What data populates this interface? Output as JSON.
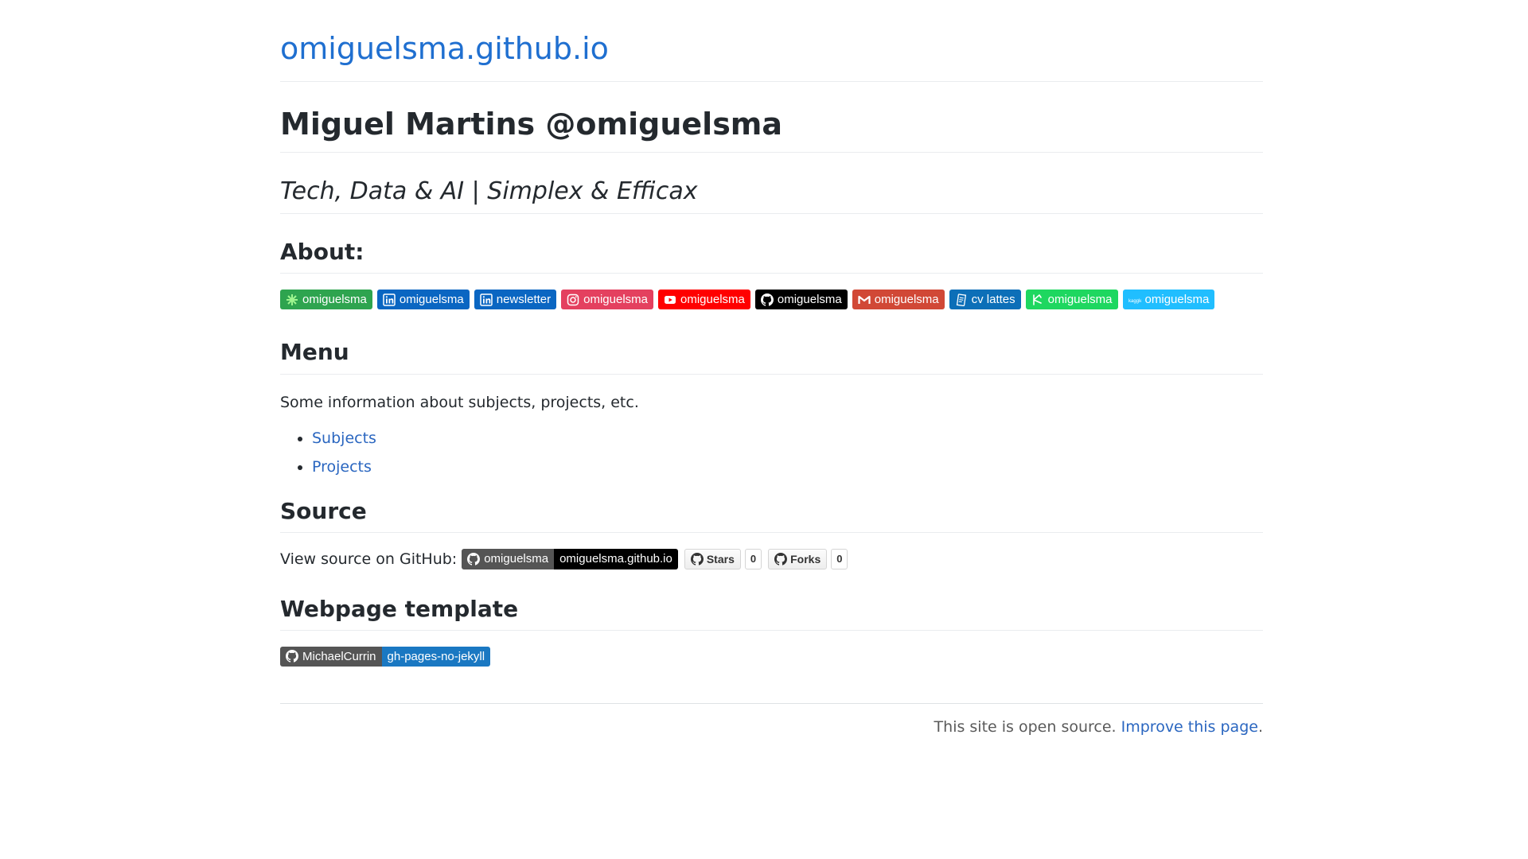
{
  "header": {
    "site_title": "omiguelsma.github.io"
  },
  "profile": {
    "name": "Miguel Martins @omiguelsma",
    "tagline": "Tech, Data & AI | Simplex & Efficax"
  },
  "about": {
    "heading": "About:",
    "badges": [
      {
        "label": "omiguelsma",
        "icon": "sparkle-icon",
        "color": "#2ea44f"
      },
      {
        "label": "omiguelsma",
        "icon": "linkedin-icon",
        "color": "#0a66c2"
      },
      {
        "label": "newsletter",
        "icon": "linkedin-icon",
        "color": "#0a66c2"
      },
      {
        "label": "omiguelsma",
        "icon": "instagram-icon",
        "color": "#e4405f"
      },
      {
        "label": "omiguelsma",
        "icon": "youtube-icon",
        "color": "#ff0000"
      },
      {
        "label": "omiguelsma",
        "icon": "github-icon",
        "color": "#000000"
      },
      {
        "label": "omiguelsma",
        "icon": "gmail-icon",
        "color": "#d14836"
      },
      {
        "label": "cv lattes",
        "icon": "document-icon",
        "color": "#0c6fb8"
      },
      {
        "label": "omiguelsma",
        "icon": "kick-icon",
        "color": "#1ed760"
      },
      {
        "label": "omiguelsma",
        "icon": "kaggle-icon",
        "color": "#20beff"
      }
    ]
  },
  "menu": {
    "heading": "Menu",
    "description": "Some information about subjects, projects, etc.",
    "items": [
      "Subjects",
      "Projects"
    ]
  },
  "source": {
    "heading": "Source",
    "label": "View source on GitHub:",
    "repo_badge_left": "omiguelsma",
    "repo_badge_right": "omiguelsma.github.io",
    "stars_label": "Stars",
    "stars_count": "0",
    "forks_label": "Forks",
    "forks_count": "0"
  },
  "template": {
    "heading": "Webpage template",
    "badge_left": "MichaelCurrin",
    "badge_right": "gh-pages-no-jekyll"
  },
  "footer": {
    "text": "This site is open source.",
    "link": "Improve this page",
    "suffix": "."
  }
}
